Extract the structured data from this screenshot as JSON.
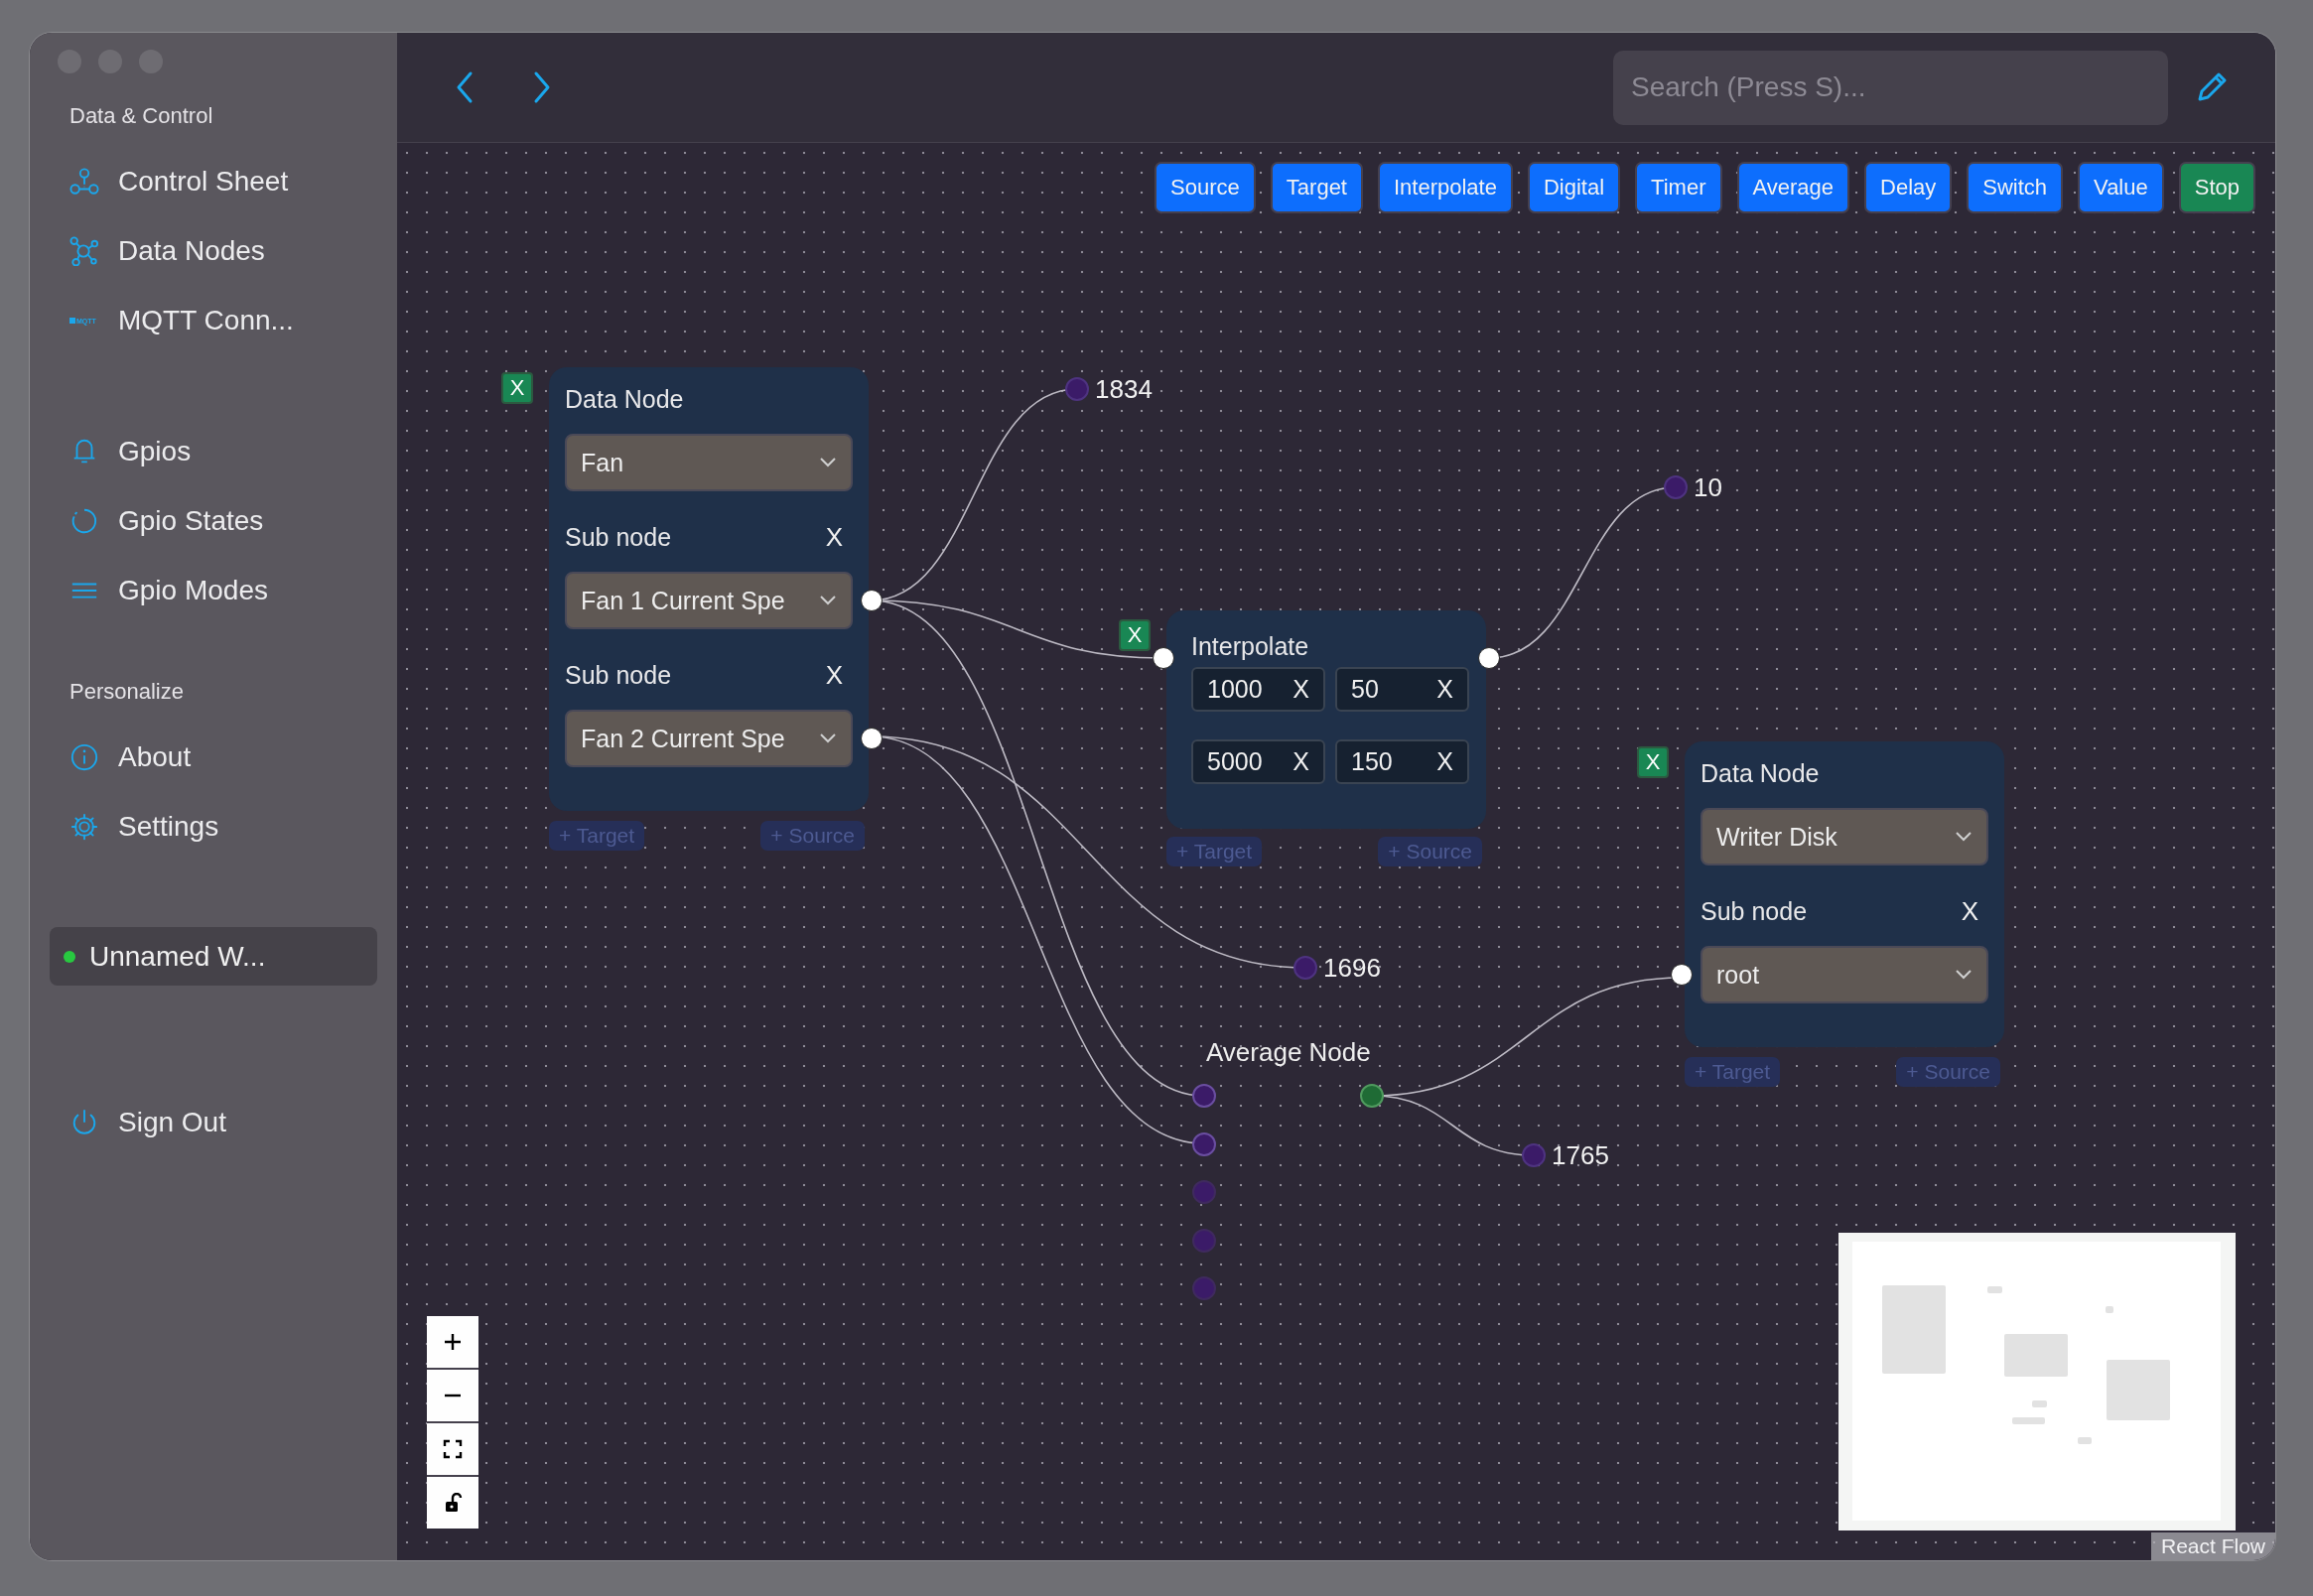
{
  "sidebar": {
    "sections": [
      {
        "title": "Data & Control",
        "items": [
          {
            "label": "Control Sheet"
          },
          {
            "label": "Data Nodes"
          },
          {
            "label": "MQTT Conn...",
            "badge": "MQTT"
          }
        ]
      },
      {
        "items": [
          {
            "label": "Gpios"
          },
          {
            "label": "Gpio States"
          },
          {
            "label": "Gpio Modes"
          }
        ]
      },
      {
        "title": "Personalize",
        "items": [
          {
            "label": "About"
          },
          {
            "label": "Settings"
          }
        ]
      }
    ],
    "workspace": {
      "label": "Unnamed W...",
      "color": "#28c840"
    },
    "sign_out": {
      "label": "Sign Out"
    }
  },
  "header": {
    "search": {
      "placeholder": "Search (Press S)..."
    }
  },
  "toolbar": [
    {
      "label": "Source",
      "kind": "add"
    },
    {
      "label": "Target",
      "kind": "add"
    },
    {
      "label": "Interpolate",
      "kind": "add"
    },
    {
      "label": "Digital",
      "kind": "add"
    },
    {
      "label": "Timer",
      "kind": "add"
    },
    {
      "label": "Average",
      "kind": "add"
    },
    {
      "label": "Delay",
      "kind": "add"
    },
    {
      "label": "Switch",
      "kind": "add"
    },
    {
      "label": "Value",
      "kind": "add"
    },
    {
      "label": "Stop",
      "kind": "stop"
    }
  ],
  "canvas": {
    "nodes": [
      {
        "kind": "data",
        "remove": "X",
        "title": "Data Node",
        "select": "Fan",
        "subnodes": [
          {
            "label": "Sub node",
            "remove": "X",
            "value": "Fan 1 Current Spe",
            "kind": "source"
          },
          {
            "label": "Sub node",
            "remove": "X",
            "value": "Fan 2 Current Spe",
            "kind": "source"
          }
        ],
        "add_target": "+ Target",
        "add_source": "+ Source"
      },
      {
        "kind": "value",
        "value": "1834"
      },
      {
        "kind": "value",
        "value": "10"
      },
      {
        "kind": "interpolate",
        "remove": "X",
        "title": "Interpolate",
        "rows": [
          [
            {
              "value": "1000",
              "remove": "X"
            },
            {
              "value": "50",
              "remove": "X"
            }
          ],
          [
            {
              "value": "5000",
              "remove": "X"
            },
            {
              "value": "150",
              "remove": "X"
            }
          ]
        ],
        "add_target": "+ Target",
        "add_source": "+ Source"
      },
      {
        "kind": "data",
        "remove": "X",
        "title": "Data Node",
        "select": "Writer Disk",
        "subnodes": [
          {
            "label": "Sub node",
            "remove": "X",
            "value": "root",
            "kind": "target"
          }
        ],
        "add_target": "+ Target",
        "add_source": "+ Source"
      },
      {
        "kind": "value",
        "value": "1696"
      },
      {
        "kind": "average",
        "title": "Average Node",
        "inputs": [
          {
            "connected": true
          },
          {
            "connected": true
          },
          {
            "connected": false
          },
          {
            "connected": false
          },
          {
            "connected": false
          }
        ],
        "output": {
          "connected": true
        }
      },
      {
        "kind": "value",
        "value": "1765"
      }
    ],
    "attribution": "React Flow"
  }
}
